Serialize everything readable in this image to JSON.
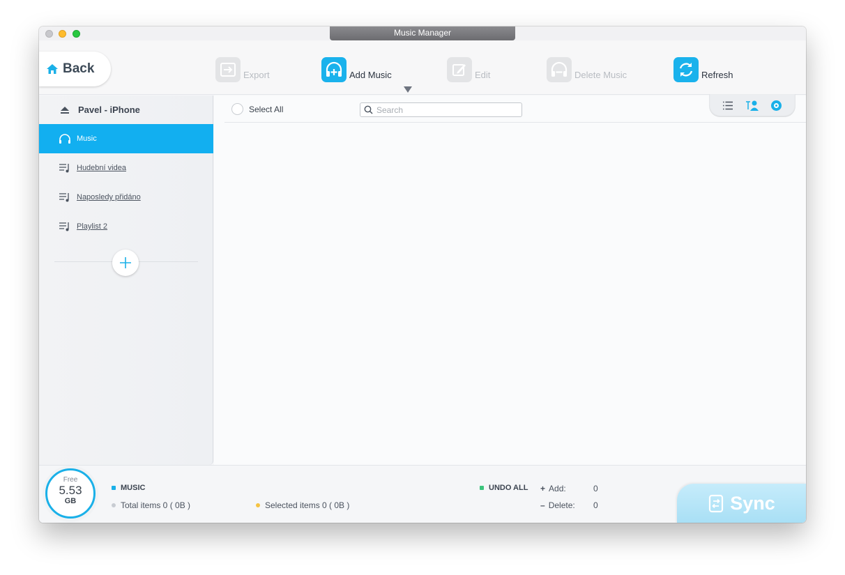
{
  "window": {
    "title": "Music Manager"
  },
  "toolbar": {
    "back_label": "Back",
    "export_label": "Export",
    "add_music_label": "Add Music",
    "edit_label": "Edit",
    "delete_music_label": "Delete Music",
    "refresh_label": "Refresh"
  },
  "sidebar": {
    "device_name": "Pavel - iPhone",
    "items": [
      {
        "label": "Music",
        "icon": "headphones-icon",
        "selected": true
      },
      {
        "label": "Hudební videa",
        "icon": "playlist-icon",
        "selected": false
      },
      {
        "label": "Naposledy přidáno",
        "icon": "playlist-icon",
        "selected": false
      },
      {
        "label": "Playlist 2",
        "icon": "playlist-icon",
        "selected": false
      }
    ]
  },
  "main": {
    "select_all_label": "Select All",
    "search_placeholder": "Search"
  },
  "footer": {
    "free_label": "Free",
    "free_value": "5.53",
    "free_unit": "GB",
    "section_label": "MUSIC",
    "total_items": "Total items 0 ( 0B )",
    "selected_items": "Selected items 0 ( 0B )",
    "undo_all_label": "UNDO ALL",
    "add_label": "Add:",
    "add_value": "0",
    "delete_label": "Delete:",
    "delete_value": "0",
    "sync_label": "Sync"
  },
  "colors": {
    "accent": "#12aff0",
    "undo_dot": "#3cc47c",
    "selected_dot": "#f5c342",
    "total_dot": "#c8ccd2"
  }
}
